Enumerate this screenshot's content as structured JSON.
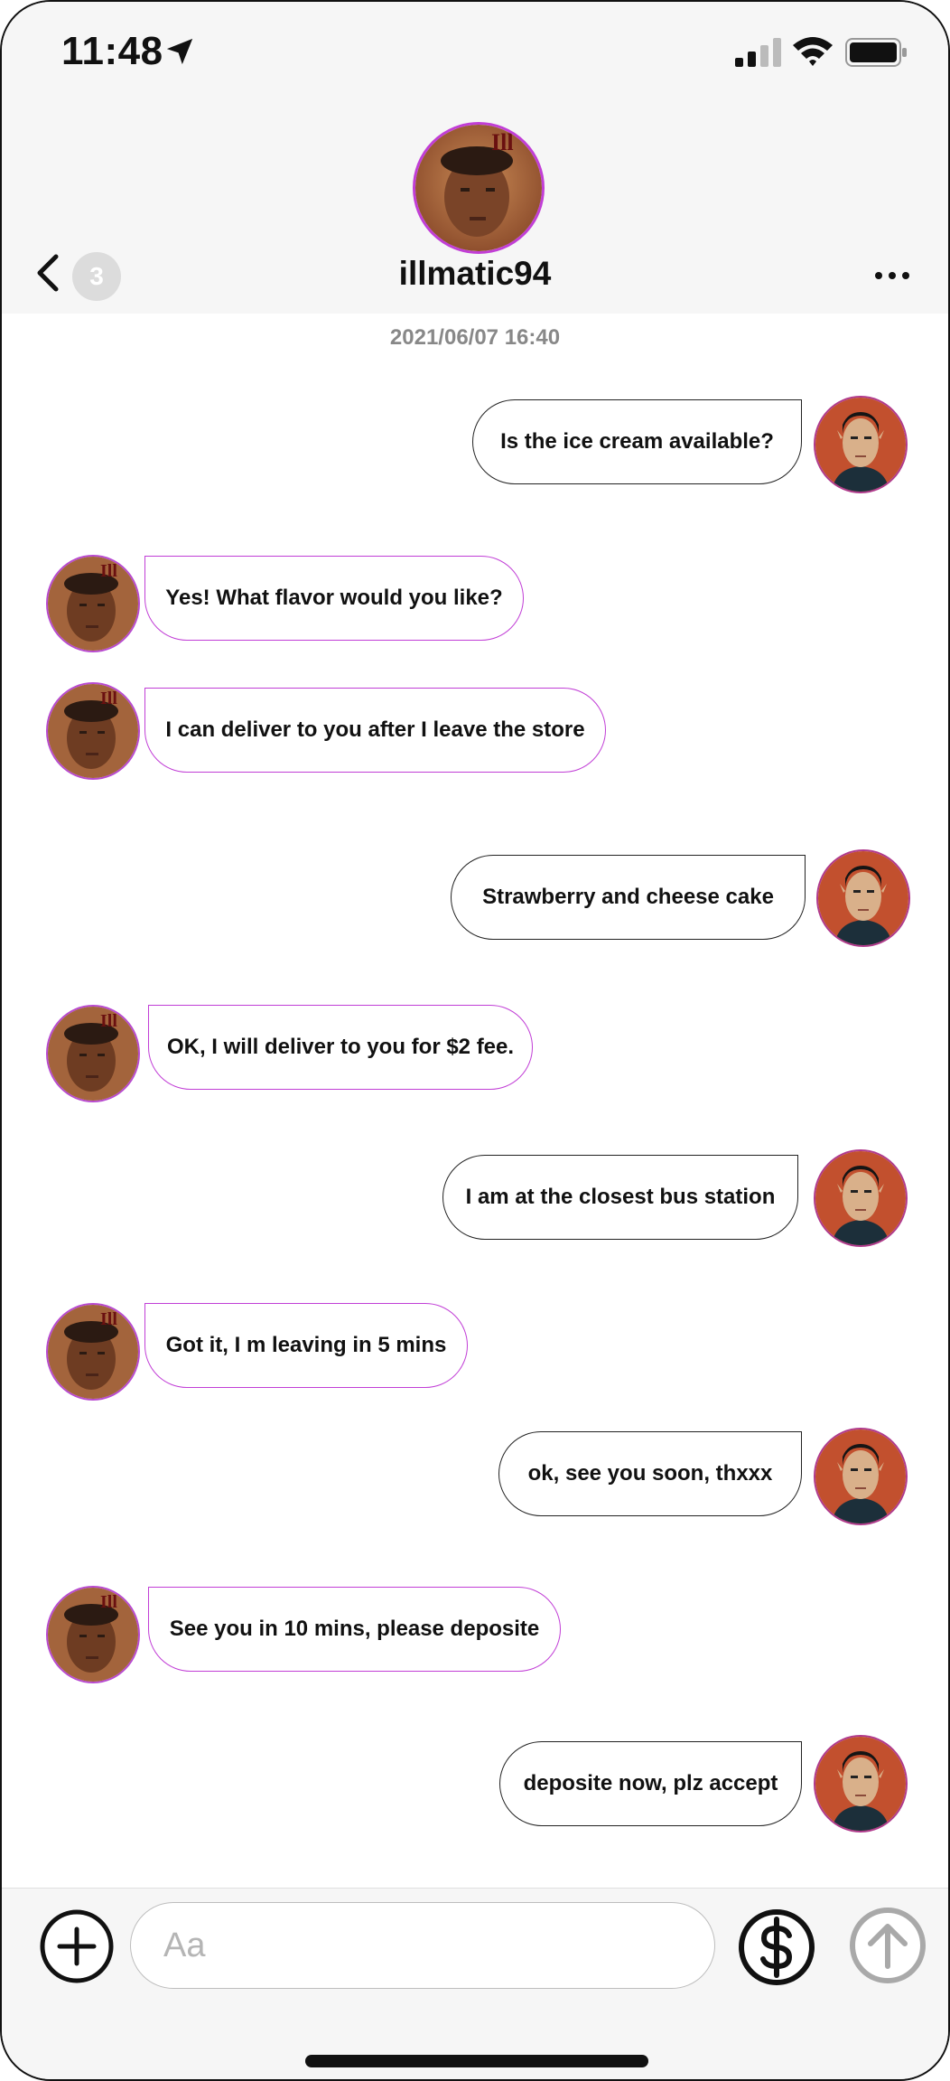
{
  "status_bar": {
    "time": "11:48"
  },
  "header": {
    "contact_name": "illmatic94",
    "unread_count": "3"
  },
  "conversation": {
    "timestamp": "2021/06/07 16:40",
    "messages": [
      {
        "from": "me",
        "text": "Is the ice cream available?"
      },
      {
        "from": "contact",
        "text": "Yes! What flavor would you like?"
      },
      {
        "from": "contact",
        "text": "I can deliver to you after I leave the store"
      },
      {
        "from": "me",
        "text": "Strawberry and cheese cake"
      },
      {
        "from": "contact",
        "text": "OK, I will deliver to you for $2 fee."
      },
      {
        "from": "me",
        "text": "I am at the closest bus station"
      },
      {
        "from": "contact",
        "text": "Got it, I m leaving in 5 mins"
      },
      {
        "from": "me",
        "text": "ok, see you soon, thxxx"
      },
      {
        "from": "contact",
        "text": "See you in 10 mins, please deposite"
      },
      {
        "from": "me",
        "text": "deposite now, plz accept"
      }
    ]
  },
  "composer": {
    "placeholder": "Aa"
  },
  "colors": {
    "accent": "#c13ed6",
    "header_bg": "#f6f6f6"
  },
  "icons": [
    "location-arrow-icon",
    "signal-icon",
    "wifi-icon",
    "battery-icon",
    "back-chevron-icon",
    "more-dots-icon",
    "plus-icon",
    "dollar-icon",
    "send-arrow-icon"
  ]
}
